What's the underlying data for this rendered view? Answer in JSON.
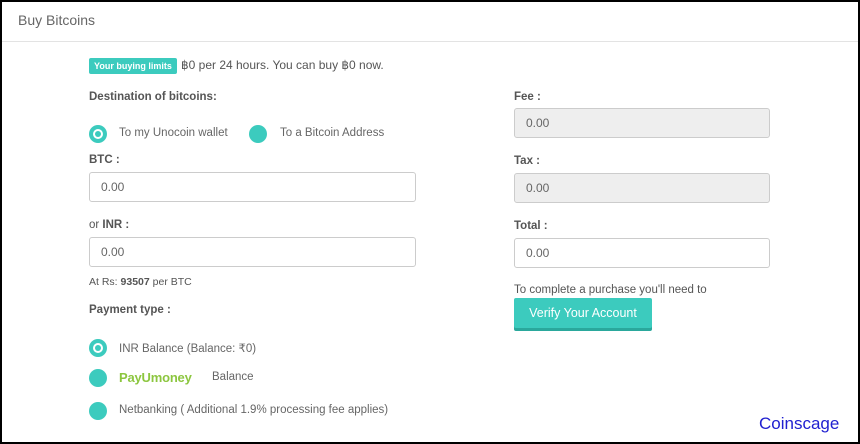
{
  "header": {
    "title": "Buy Bitcoins"
  },
  "limits": {
    "badge": "Your buying limits",
    "text": "฿0 per 24 hours. You can buy ฿0 now."
  },
  "destination": {
    "label": "Destination of bitcoins:",
    "options": [
      "To my Unocoin wallet",
      "To a Bitcoin Address"
    ]
  },
  "btc": {
    "label": "BTC :",
    "value": "0.00"
  },
  "inr": {
    "label_prefix": "or ",
    "label": "INR :",
    "value": "0.00"
  },
  "rate": {
    "prefix": "At Rs: ",
    "value": "93507",
    "suffix": " per BTC"
  },
  "payment": {
    "label": "Payment type :",
    "options": {
      "inr_balance": "INR Balance (Balance: ₹0)",
      "payu_logo": "PayUmoney",
      "payu_suffix": "Balance",
      "netbanking": "Netbanking ( Additional 1.9% processing fee applies)"
    }
  },
  "fee": {
    "label": "Fee :",
    "value": "0.00"
  },
  "tax": {
    "label": "Tax :",
    "value": "0.00"
  },
  "total": {
    "label": "Total :",
    "value": "0.00"
  },
  "purchase_note": "To complete a purchase you'll need to",
  "verify_button": "Verify Your Account",
  "watermark": "Coinscage",
  "colors": {
    "accent": "#3ccbbe",
    "payu": "#8cc63f",
    "watermark": "#2020d0"
  }
}
